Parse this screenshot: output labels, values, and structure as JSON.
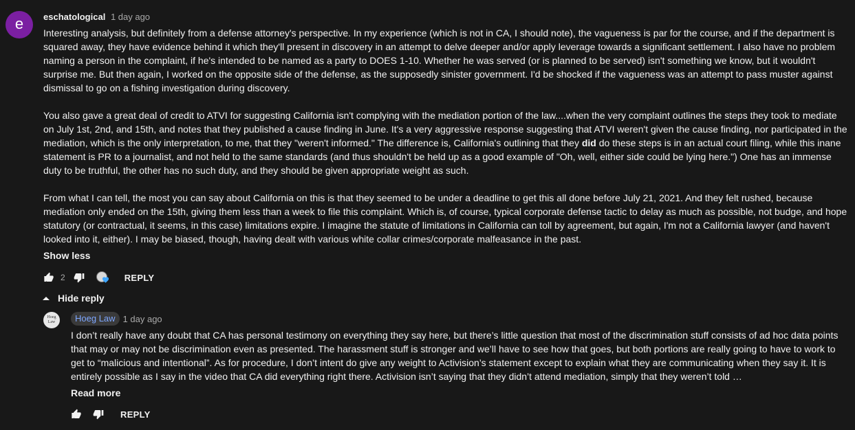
{
  "comment": {
    "avatar_letter": "e",
    "avatar_color": "#7b1fa2",
    "author": "eschatological",
    "time": "1 day ago",
    "paragraphs": [
      {
        "parts": [
          "Interesting analysis, but definitely from a defense attorney's perspective. In my experience (which is not in CA, I should note), the vagueness is par for the course, and if the department is squared away, they have evidence behind it which they'll present in discovery in an attempt to delve deeper and/or apply leverage towards a significant settlement. I also have no problem naming a person in the complaint, if he's intended to be named as a party to DOES 1-10. Whether he was served (or is planned to be served) isn't something we know, but it wouldn't surprise me. But then again, I worked on the opposite side of the defense, as the supposedly sinister government. I'd be shocked if the vagueness was an attempt to pass muster against dismissal to go on a fishing investigation during discovery."
        ]
      },
      {
        "before": "You also gave a great deal of credit to ATVI for suggesting California isn't complying with the mediation portion of the law....when the very complaint outlines the steps they took to mediate on July 1st, 2nd, and 15th, and notes that they published a cause finding in June. It's a very aggressive response suggesting that ATVI weren't given the cause finding, nor participated in the mediation, which is the only interpretation, to me, that they \"weren't informed.\" The difference is, California's outlining that they ",
        "bold": "did",
        "after": " do these steps is in an actual court filing, while this inane statement is PR to a journalist, and not held to the same standards (and thus shouldn't be held up as a good example of \"Oh, well, either side could be lying here.\") One has an immense duty to be truthful, the other has no such duty, and they should be given appropriate weight as such."
      },
      {
        "parts": [
          "From what I can tell, the most you can say about California on this is that they seemed to be under a deadline to get this all done before July 21, 2021. And they felt rushed, because mediation only ended on the 15th, giving them less than a week to file this complaint. Which is, of course, typical corporate defense tactic to delay as much as possible, not budge, and hope statutory (or contractual, it seems, in this case) limitations expire. I imagine the statute of limitations in California can toll by agreement, but again, I'm not a California lawyer (and haven't looked into it, either). I may be biased, though, having dealt with various white collar crimes/corporate malfeasance in the past."
        ]
      }
    ],
    "show_less": "Show less",
    "like_count": "2",
    "reply_label": "REPLY",
    "hide_reply": "Hide reply"
  },
  "reply": {
    "avatar_text_1": "Hoeg",
    "avatar_text_2": "Law",
    "author": "Hoeg Law",
    "author_badge_color": "#7ea7ff",
    "time": "1 day ago",
    "text": "I don’t really have any doubt that CA has personal testimony on everything they say here, but there’s little question that most of the discrimination stuff consists of ad hoc data points that may or may not be discrimination even as presented.  The harassment stuff is stronger and we’ll have to see how that goes, but both portions are really going to have to work to get to “malicious and intentional”.  As for procedure, I don’t intent do give any weight to Activision’s statement except to explain what they are communicating when they say it.  It is entirely possible as I say in the video that CA did everything right there.  Activision isn’t saying that they didn’t attend mediation, simply that they weren’t told …",
    "read_more": "Read more",
    "reply_label": "REPLY"
  },
  "colors": {
    "background": "#181818",
    "text": "#f1f1f1",
    "muted": "#aaaaaa",
    "heart": "#3ea6ff"
  }
}
